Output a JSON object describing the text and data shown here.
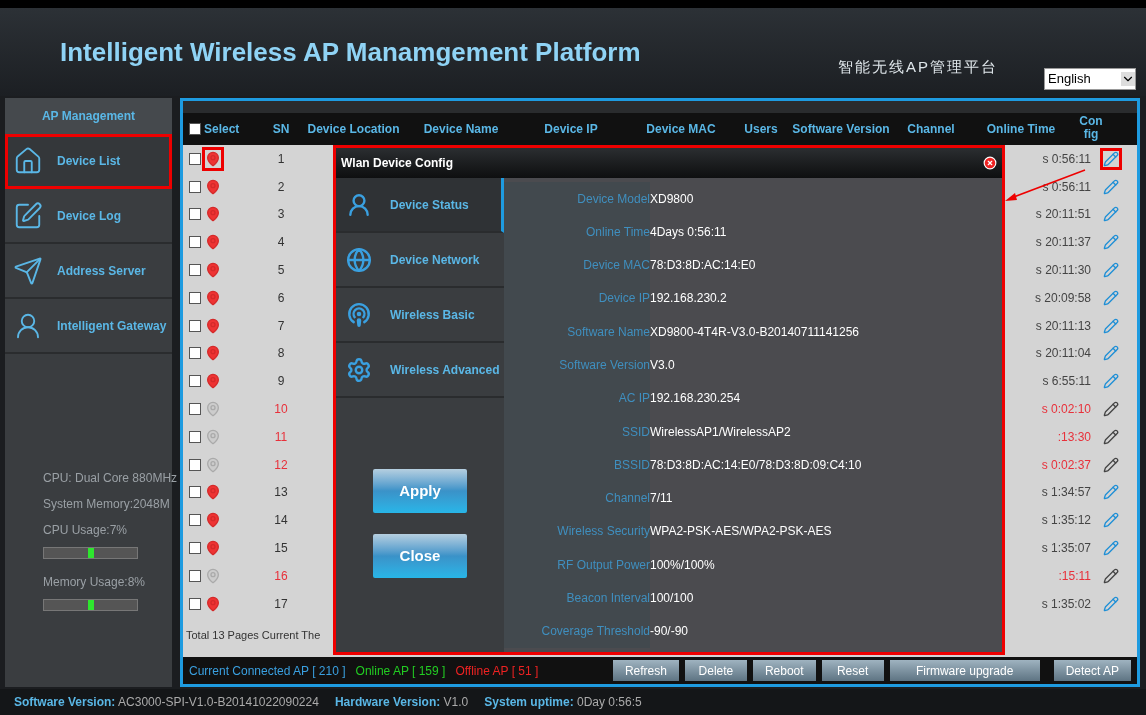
{
  "header": {
    "title": "Intelligent Wireless AP Manamgement Platform",
    "subtitle": "智能无线AP管理平台",
    "language": "English"
  },
  "sidebar": {
    "section": "AP Management",
    "items": [
      {
        "label": "Device List",
        "kind": "list",
        "selected": true
      },
      {
        "label": "Device Log",
        "kind": "log",
        "selected": false
      },
      {
        "label": "Address Server",
        "kind": "server",
        "selected": false
      },
      {
        "label": "Intelligent Gateway",
        "kind": "gateway",
        "selected": false
      }
    ],
    "system_info": [
      {
        "kind": "text",
        "text": "CPU: Dual Core 880MHz"
      },
      {
        "kind": "text",
        "text": "System Memory:2048M"
      },
      {
        "kind": "text",
        "text": "CPU Usage:7%"
      },
      {
        "kind": "meter"
      },
      {
        "kind": "text",
        "text": "Memory Usage:8%"
      },
      {
        "kind": "meter"
      }
    ]
  },
  "table": {
    "select_all": {
      "label": "Select",
      "checked": false
    },
    "columns": [
      "SN",
      "Device Location",
      "Device Name",
      "Device IP",
      "Device MAC",
      "Users",
      "Software Version",
      "Channel",
      "Online Time",
      "Config"
    ],
    "rows": [
      {
        "sn": "1",
        "online": true,
        "online_time": "s 0:56:11",
        "checked": false,
        "highlighted": true
      },
      {
        "sn": "2",
        "online": true,
        "online_time": "s 0:56:11",
        "checked": false,
        "highlighted": false
      },
      {
        "sn": "3",
        "online": true,
        "online_time": "s 20:11:51",
        "checked": false,
        "highlighted": false
      },
      {
        "sn": "4",
        "online": true,
        "online_time": "s 20:11:37",
        "checked": false,
        "highlighted": false
      },
      {
        "sn": "5",
        "online": true,
        "online_time": "s 20:11:30",
        "checked": false,
        "highlighted": false
      },
      {
        "sn": "6",
        "online": true,
        "online_time": "s 20:09:58",
        "checked": false,
        "highlighted": false
      },
      {
        "sn": "7",
        "online": true,
        "online_time": "s 20:11:13",
        "checked": false,
        "highlighted": false
      },
      {
        "sn": "8",
        "online": true,
        "online_time": "s 20:11:04",
        "checked": false,
        "highlighted": false
      },
      {
        "sn": "9",
        "online": true,
        "online_time": "s 6:55:11",
        "checked": false,
        "highlighted": false
      },
      {
        "sn": "10",
        "online": false,
        "online_time": "s 0:02:10",
        "checked": false,
        "highlighted": false
      },
      {
        "sn": "11",
        "online": false,
        "online_time": ":13:30",
        "checked": false,
        "highlighted": false
      },
      {
        "sn": "12",
        "online": false,
        "online_time": "s 0:02:37",
        "checked": false,
        "highlighted": false
      },
      {
        "sn": "13",
        "online": true,
        "online_time": "s 1:34:57",
        "checked": false,
        "highlighted": false
      },
      {
        "sn": "14",
        "online": true,
        "online_time": "s 1:35:12",
        "checked": false,
        "highlighted": false
      },
      {
        "sn": "15",
        "online": true,
        "online_time": "s 1:35:07",
        "checked": false,
        "highlighted": false
      },
      {
        "sn": "16",
        "online": false,
        "online_time": ":15:11",
        "checked": false,
        "highlighted": false
      },
      {
        "sn": "17",
        "online": true,
        "online_time": "s 1:35:02",
        "checked": false,
        "highlighted": false
      }
    ],
    "pagination": "Total 13 Pages Current The"
  },
  "ap_stats": [
    {
      "text": "Current Connected AP [ 210 ]",
      "color": "#3aa0e0"
    },
    {
      "text": "Online AP [ 159 ]",
      "color": "#22cc22"
    },
    {
      "text": "Offline AP [ 51 ]",
      "color": "#ee2222"
    }
  ],
  "actions": [
    "Refresh",
    "Delete",
    "Reboot",
    "Reset",
    "Firmware upgrade",
    "Detect AP"
  ],
  "dialog": {
    "title": "Wlan Device Config",
    "nav": [
      {
        "label": "Device Status",
        "kind": "status",
        "selected": true
      },
      {
        "label": "Device Network",
        "kind": "network",
        "selected": false
      },
      {
        "label": "Wireless Basic",
        "kind": "basic",
        "selected": false
      },
      {
        "label": "Wireless Advanced",
        "kind": "advanced",
        "selected": false
      }
    ],
    "fields": [
      {
        "label": "Device Model",
        "value": "XD9800"
      },
      {
        "label": "Online Time",
        "value": "4Days 0:56:11"
      },
      {
        "label": "Device MAC",
        "value": "78:D3:8D:AC:14:E0"
      },
      {
        "label": "Device IP",
        "value": "192.168.230.2"
      },
      {
        "label": "Software Name",
        "value": "XD9800-4T4R-V3.0-B20140711141256"
      },
      {
        "label": "Software Version",
        "value": "V3.0"
      },
      {
        "label": "AC IP",
        "value": "192.168.230.254"
      },
      {
        "label": "SSID",
        "value": "WirelessAP1/WirelessAP2"
      },
      {
        "label": "BSSID",
        "value": "78:D3:8D:AC:14:E0/78:D3:8D:09:C4:10"
      },
      {
        "label": "Channel",
        "value": "7/11"
      },
      {
        "label": "Wireless Security",
        "value": "WPA2-PSK-AES/WPA2-PSK-AES"
      },
      {
        "label": "RF Output Power",
        "value": "100%/100%"
      },
      {
        "label": "Beacon Interval",
        "value": "100/100"
      },
      {
        "label": "Coverage Threshold",
        "value": "-90/-90"
      }
    ],
    "buttons": [
      "Apply",
      "Close"
    ]
  },
  "status_bar": [
    {
      "label": "Software Version:",
      "value": "AC3000-SPI-V1.0-B20141022090224"
    },
    {
      "label": "Hardware Version:",
      "value": "V1.0"
    },
    {
      "label": "System uptime:",
      "value": "0Day 0:56:5"
    }
  ]
}
